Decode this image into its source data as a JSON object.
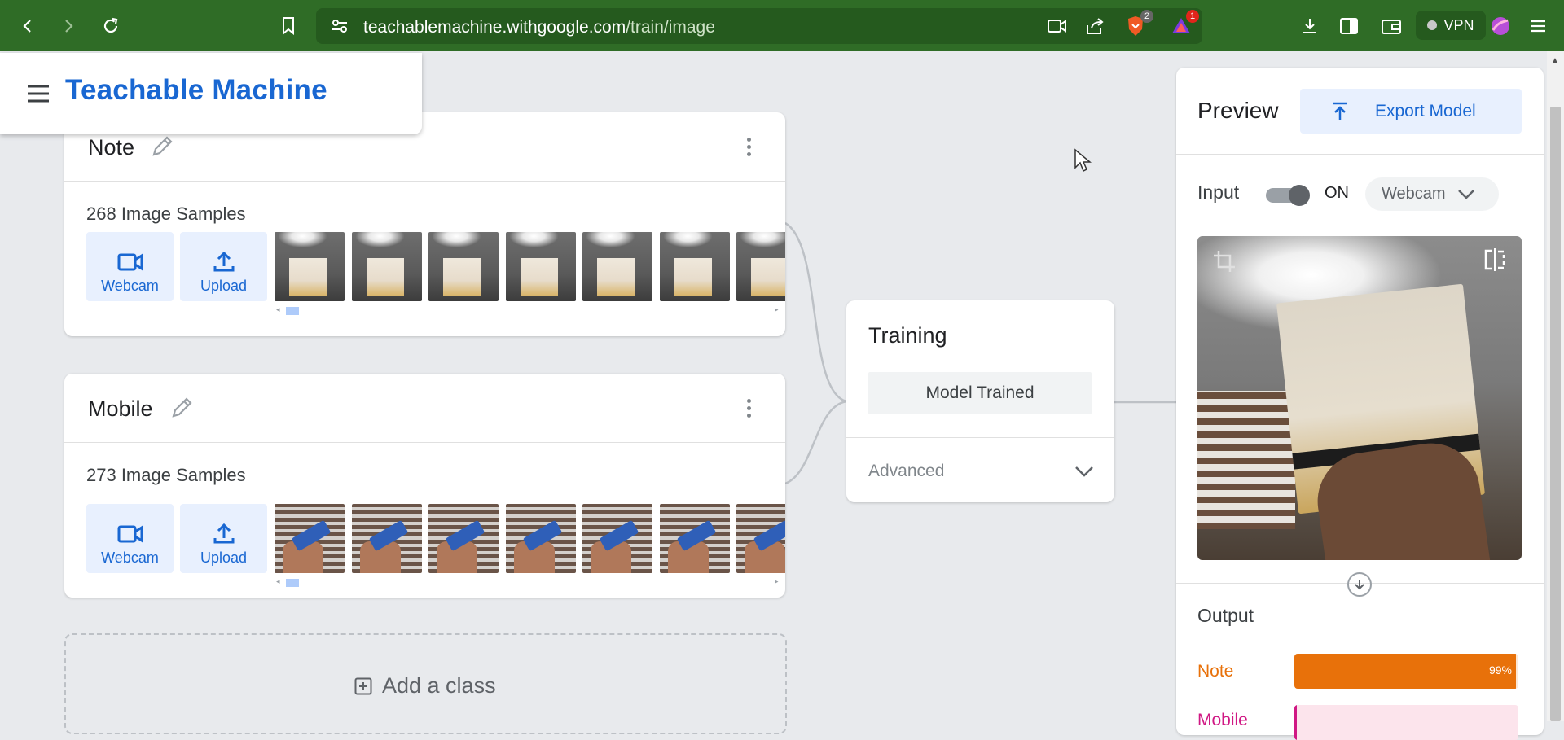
{
  "browser": {
    "url_host": "teachablemachine.withgoogle.com",
    "url_path": "/train/image",
    "brave_badge": "2",
    "alert_badge": "1",
    "vpn_label": "VPN"
  },
  "app": {
    "title": "Teachable Machine"
  },
  "classes": [
    {
      "name": "Note",
      "sample_count": "268 Image Samples",
      "webcam_label": "Webcam",
      "upload_label": "Upload"
    },
    {
      "name": "Mobile",
      "sample_count": "273 Image Samples",
      "webcam_label": "Webcam",
      "upload_label": "Upload"
    }
  ],
  "add_class_label": "Add a class",
  "training": {
    "title": "Training",
    "status_button": "Model Trained",
    "advanced_label": "Advanced"
  },
  "preview": {
    "title": "Preview",
    "export_label": "Export Model",
    "input_label": "Input",
    "toggle_state": "ON",
    "input_source": "Webcam",
    "output_label": "Output",
    "outputs": [
      {
        "label": "Note",
        "confidence": 0.99,
        "percent_text": "99%",
        "color": "#e8710a",
        "track": "#fce8d6"
      },
      {
        "label": "Mobile",
        "confidence": 0.01,
        "percent_text": "",
        "color": "#d01884",
        "track": "#fce4ec"
      }
    ]
  },
  "colors": {
    "brand_blue": "#1967d2",
    "chrome_green": "#2f6c26"
  }
}
